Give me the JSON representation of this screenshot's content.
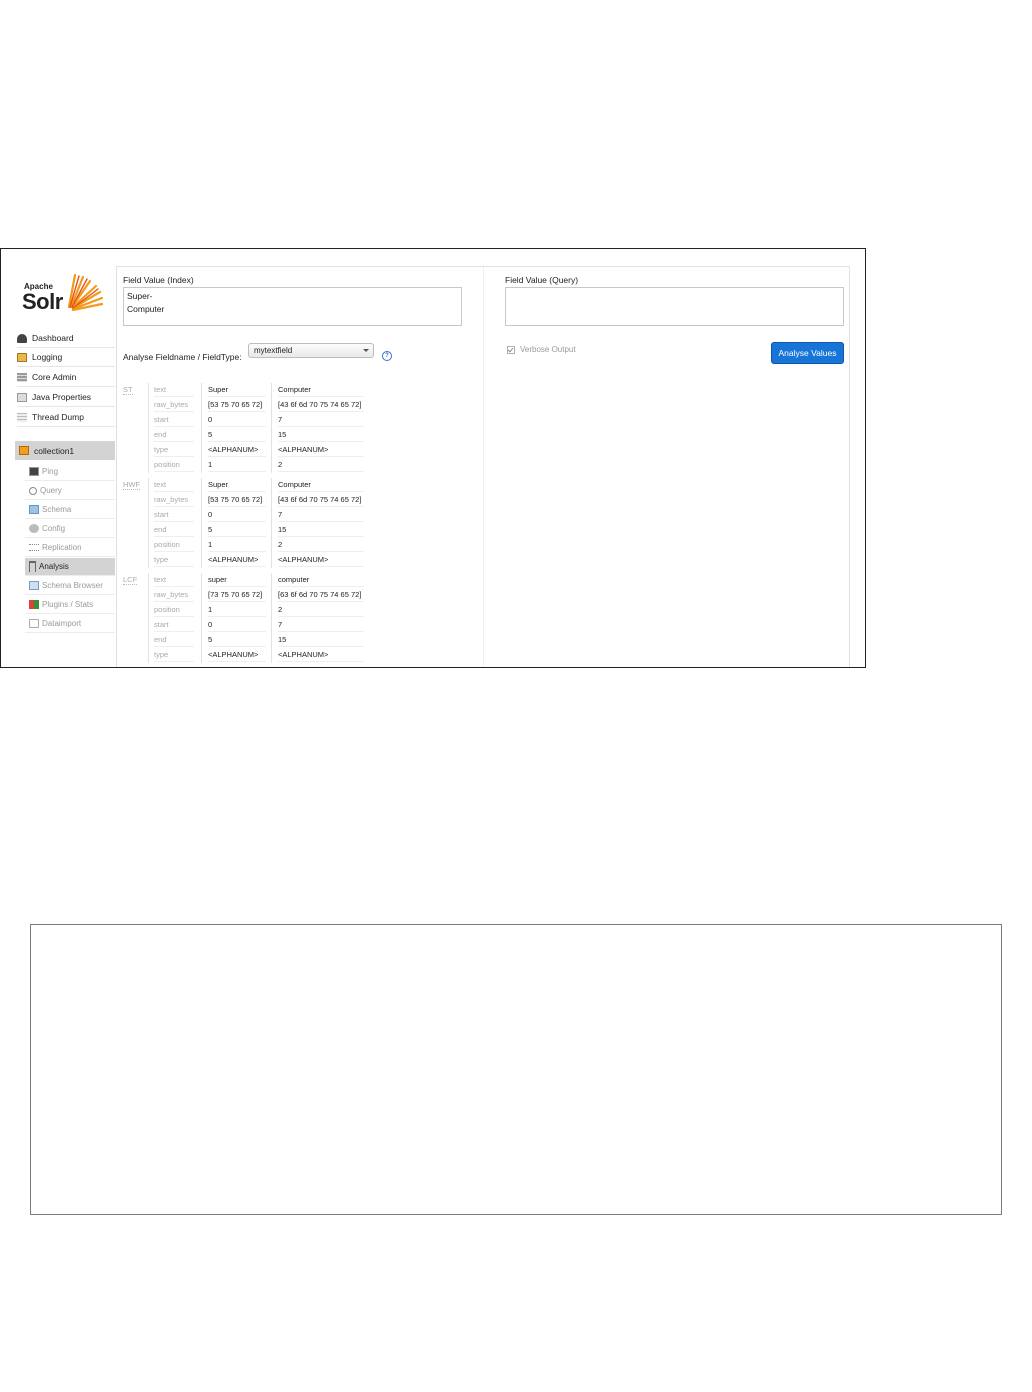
{
  "logo": {
    "apache": "Apache",
    "solr": "Solr"
  },
  "nav": [
    {
      "label": "Dashboard",
      "icon": "dashboard-icon"
    },
    {
      "label": "Logging",
      "icon": "logging-icon"
    },
    {
      "label": "Core Admin",
      "icon": "core-admin-icon"
    },
    {
      "label": "Java Properties",
      "icon": "java-properties-icon"
    },
    {
      "label": "Thread Dump",
      "icon": "thread-dump-icon"
    }
  ],
  "core": {
    "label": "collection1"
  },
  "core_menu": [
    {
      "label": "Ping",
      "icon": "ping-icon"
    },
    {
      "label": "Query",
      "icon": "query-icon"
    },
    {
      "label": "Schema",
      "icon": "schema-icon"
    },
    {
      "label": "Config",
      "icon": "config-icon"
    },
    {
      "label": "Replication",
      "icon": "replication-icon"
    },
    {
      "label": "Analysis",
      "icon": "analysis-icon",
      "active": true
    },
    {
      "label": "Schema Browser",
      "icon": "schema-browser-icon"
    },
    {
      "label": "Plugins / Stats",
      "icon": "plugins-icon"
    },
    {
      "label": "Dataimport",
      "icon": "dataimport-icon"
    }
  ],
  "index": {
    "label": "Field Value (Index)",
    "value": "Super-\nComputer"
  },
  "query": {
    "label": "Field Value (Query)",
    "value": ""
  },
  "fieldtype": {
    "label": "Analyse Fieldname / FieldType:",
    "selected": "mytextfield",
    "help": "?"
  },
  "verbose": {
    "label": "Verbose Output",
    "checked": true
  },
  "analyse_button": "Analyse Values",
  "stages": [
    {
      "abbr": "ST",
      "rows": [
        {
          "key": "text",
          "t1": "Super",
          "t2": "Computer"
        },
        {
          "key": "raw_bytes",
          "t1": "[53 75 70 65 72]",
          "t2": "[43 6f 6d 70 75 74 65 72]"
        },
        {
          "key": "start",
          "t1": "0",
          "t2": "7"
        },
        {
          "key": "end",
          "t1": "5",
          "t2": "15"
        },
        {
          "key": "type",
          "t1": "<ALPHANUM>",
          "t2": "<ALPHANUM>"
        },
        {
          "key": "position",
          "t1": "1",
          "t2": "2"
        }
      ]
    },
    {
      "abbr": "HWF",
      "rows": [
        {
          "key": "text",
          "t1": "Super",
          "t2": "Computer"
        },
        {
          "key": "raw_bytes",
          "t1": "[53 75 70 65 72]",
          "t2": "[43 6f 6d 70 75 74 65 72]"
        },
        {
          "key": "start",
          "t1": "0",
          "t2": "7"
        },
        {
          "key": "end",
          "t1": "5",
          "t2": "15"
        },
        {
          "key": "position",
          "t1": "1",
          "t2": "2"
        },
        {
          "key": "type",
          "t1": "<ALPHANUM>",
          "t2": "<ALPHANUM>"
        }
      ]
    },
    {
      "abbr": "LCF",
      "rows": [
        {
          "key": "text",
          "t1": "super",
          "t2": "computer"
        },
        {
          "key": "raw_bytes",
          "t1": "[73 75 70 65 72]",
          "t2": "[63 6f 6d 70 75 74 65 72]"
        },
        {
          "key": "position",
          "t1": "1",
          "t2": "2"
        },
        {
          "key": "start",
          "t1": "0",
          "t2": "7"
        },
        {
          "key": "end",
          "t1": "5",
          "t2": "15"
        },
        {
          "key": "type",
          "t1": "<ALPHANUM>",
          "t2": "<ALPHANUM>"
        }
      ]
    }
  ],
  "colors": {
    "accent": "#1675d6",
    "active_bg": "#d3d3d3",
    "logo_orange": "#f39a1c"
  }
}
